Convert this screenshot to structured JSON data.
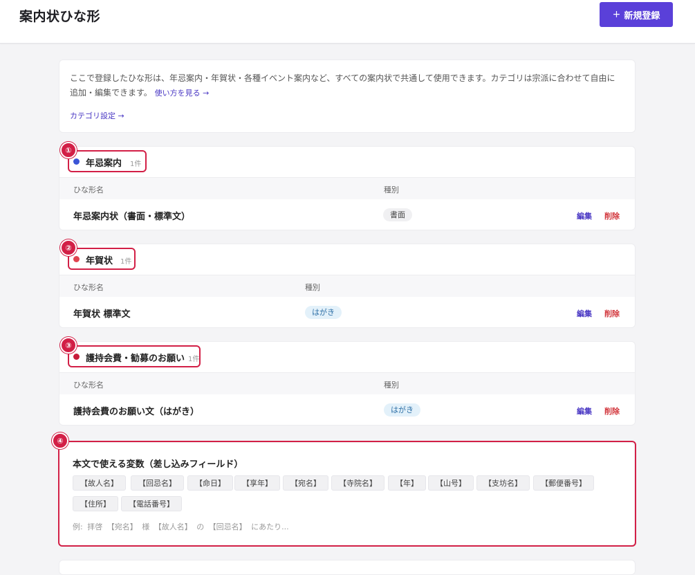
{
  "header": {
    "title": "案内状ひな形",
    "new_button_icon": "+",
    "new_button_label": "新規登録"
  },
  "info": {
    "text": "ここで登録したひな形は、年忌案内・年賀状・各種イベント案内など、すべての案内状で共通して使用できます。カテゴリは宗派に合わせて自由に追加・編集できます。",
    "howto_link": "使い方を見る →",
    "category_link": "カテゴリ設定 →"
  },
  "columns": {
    "name": "ひな形名",
    "type": "種別"
  },
  "row_actions": {
    "edit": "編集",
    "delete": "削除"
  },
  "categories": [
    {
      "marker": "①",
      "name": "年忌案内",
      "count": "1件",
      "dot_color": "#3b55d6",
      "row_name": "年忌案内状（書面・標準文）",
      "row_type": "書面"
    },
    {
      "marker": "②",
      "name": "年賀状",
      "count": "1件",
      "dot_color": "#e0434f",
      "row_name": "年賀状 標準文",
      "row_type": "はがき"
    },
    {
      "marker": "③",
      "name": "護持会費・勧募のお願い",
      "count": "1件",
      "dot_color": "#c81b3a",
      "row_name": "護持会費のお願い文（はがき）",
      "row_type": "はがき"
    }
  ],
  "variables": {
    "marker": "④",
    "title": "本文で使える変数（差し込みフィールド）",
    "chips": [
      "【故人名】",
      "【回忌名】",
      "【命日】",
      "【享年】",
      "【宛名】",
      "【寺院名】",
      "【年】",
      "【山号】",
      "【支坊名】",
      "【郵便番号】",
      "【住所】",
      "【電話番号】"
    ],
    "example": "例: 拝啓 【宛名】 様 【故人名】 の 【回忌名】 にあたり..."
  },
  "colors": {
    "accent": "#5a40d9",
    "highlight": "#d21f46",
    "delete": "#d2363c"
  }
}
